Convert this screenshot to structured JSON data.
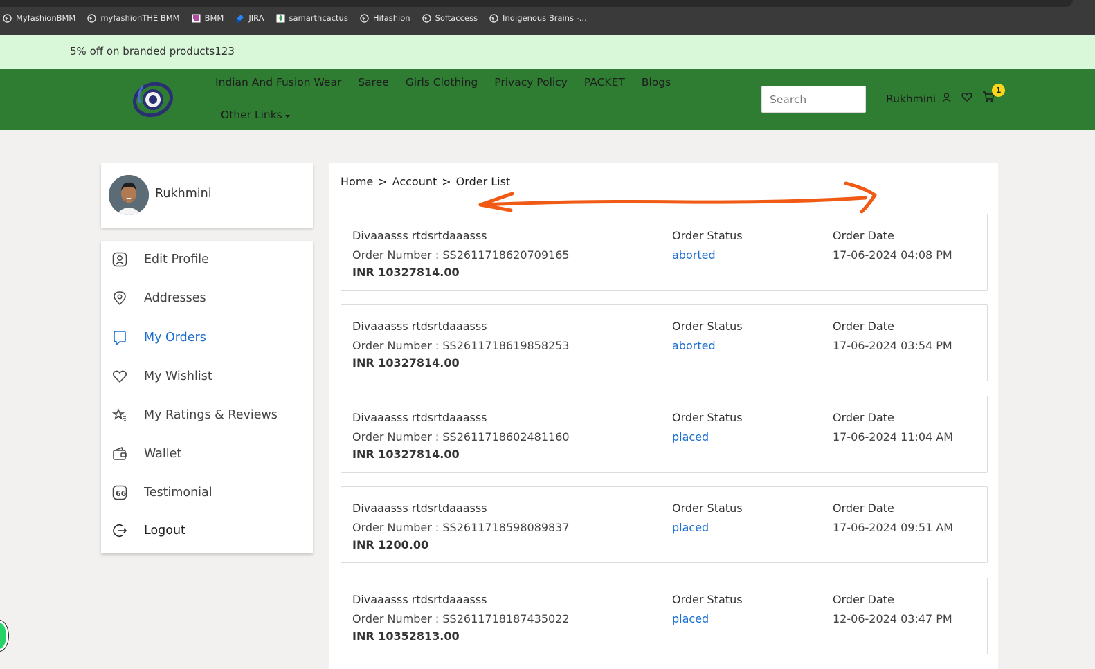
{
  "bookmarks": [
    {
      "label": "MyfashionBMM",
      "icon": "globe-icon"
    },
    {
      "label": "myfashionTHE BMM",
      "icon": "globe-icon"
    },
    {
      "label": "BMM",
      "icon": "bmm-icon"
    },
    {
      "label": "JIRA",
      "icon": "jira-icon"
    },
    {
      "label": "samarthcactus",
      "icon": "cactus-icon"
    },
    {
      "label": "Hifashion",
      "icon": "globe-icon"
    },
    {
      "label": "Softaccess",
      "icon": "globe-icon"
    },
    {
      "label": "Indigenous Brains -...",
      "icon": "globe-icon"
    }
  ],
  "promo": {
    "text": "5% off on branded products123"
  },
  "header": {
    "nav": [
      "Indian And Fusion Wear",
      "Saree",
      "Girls Clothing",
      "Privacy Policy",
      "PACKET",
      "Blogs"
    ],
    "other_links": "Other Links",
    "search_placeholder": "Search",
    "user_name": "Rukhmini",
    "cart_count": "1",
    "colors": {
      "header_bg": "#2e7d32",
      "promo_bg": "#d9f7d9",
      "badge": "#fbd71b"
    }
  },
  "sidebar": {
    "profile_name": "Rukhmini",
    "items": [
      {
        "label": "Edit Profile",
        "icon": "user-square-icon"
      },
      {
        "label": "Addresses",
        "icon": "location-pin-icon"
      },
      {
        "label": "My Orders",
        "icon": "bookmark-icon",
        "active": true
      },
      {
        "label": "My Wishlist",
        "icon": "heart-icon"
      },
      {
        "label": "My Ratings & Reviews",
        "icon": "star-rating-icon"
      },
      {
        "label": "Wallet",
        "icon": "wallet-icon"
      },
      {
        "label": "Testimonial",
        "icon": "quote-icon"
      },
      {
        "label": "Logout",
        "icon": "logout-icon"
      }
    ],
    "active_color": "#1b6fd1"
  },
  "breadcrumb": [
    "Home",
    ">",
    "Account",
    ">",
    "Order List"
  ],
  "orders": [
    {
      "title": "Divaaasss rtdsrtdaaasss",
      "number": "Order Number : SS2611718620709165",
      "amount": "INR 10327814.00",
      "status_label": "Order Status",
      "status": "aborted",
      "date_label": "Order Date",
      "date": "17-06-2024 04:08 PM"
    },
    {
      "title": "Divaaasss rtdsrtdaaasss",
      "number": "Order Number : SS2611718619858253",
      "amount": "INR 10327814.00",
      "status_label": "Order Status",
      "status": "aborted",
      "date_label": "Order Date",
      "date": "17-06-2024 03:54 PM"
    },
    {
      "title": "Divaaasss rtdsrtdaaasss",
      "number": "Order Number : SS2611718602481160",
      "amount": "INR 10327814.00",
      "status_label": "Order Status",
      "status": "placed",
      "date_label": "Order Date",
      "date": "17-06-2024 11:04 AM"
    },
    {
      "title": "Divaaasss rtdsrtdaaasss",
      "number": "Order Number : SS2611718598089837",
      "amount": "INR 1200.00",
      "status_label": "Order Status",
      "status": "placed",
      "date_label": "Order Date",
      "date": "17-06-2024 09:51 AM"
    },
    {
      "title": "Divaaasss rtdsrtdaaasss",
      "number": "Order Number : SS2611718187435022",
      "amount": "INR 10352813.00",
      "status_label": "Order Status",
      "status": "placed",
      "date_label": "Order Date",
      "date": "12-06-2024 03:47 PM"
    }
  ],
  "annotation": {
    "icon": "double-arrow-annotation",
    "color": "#f05a14"
  }
}
